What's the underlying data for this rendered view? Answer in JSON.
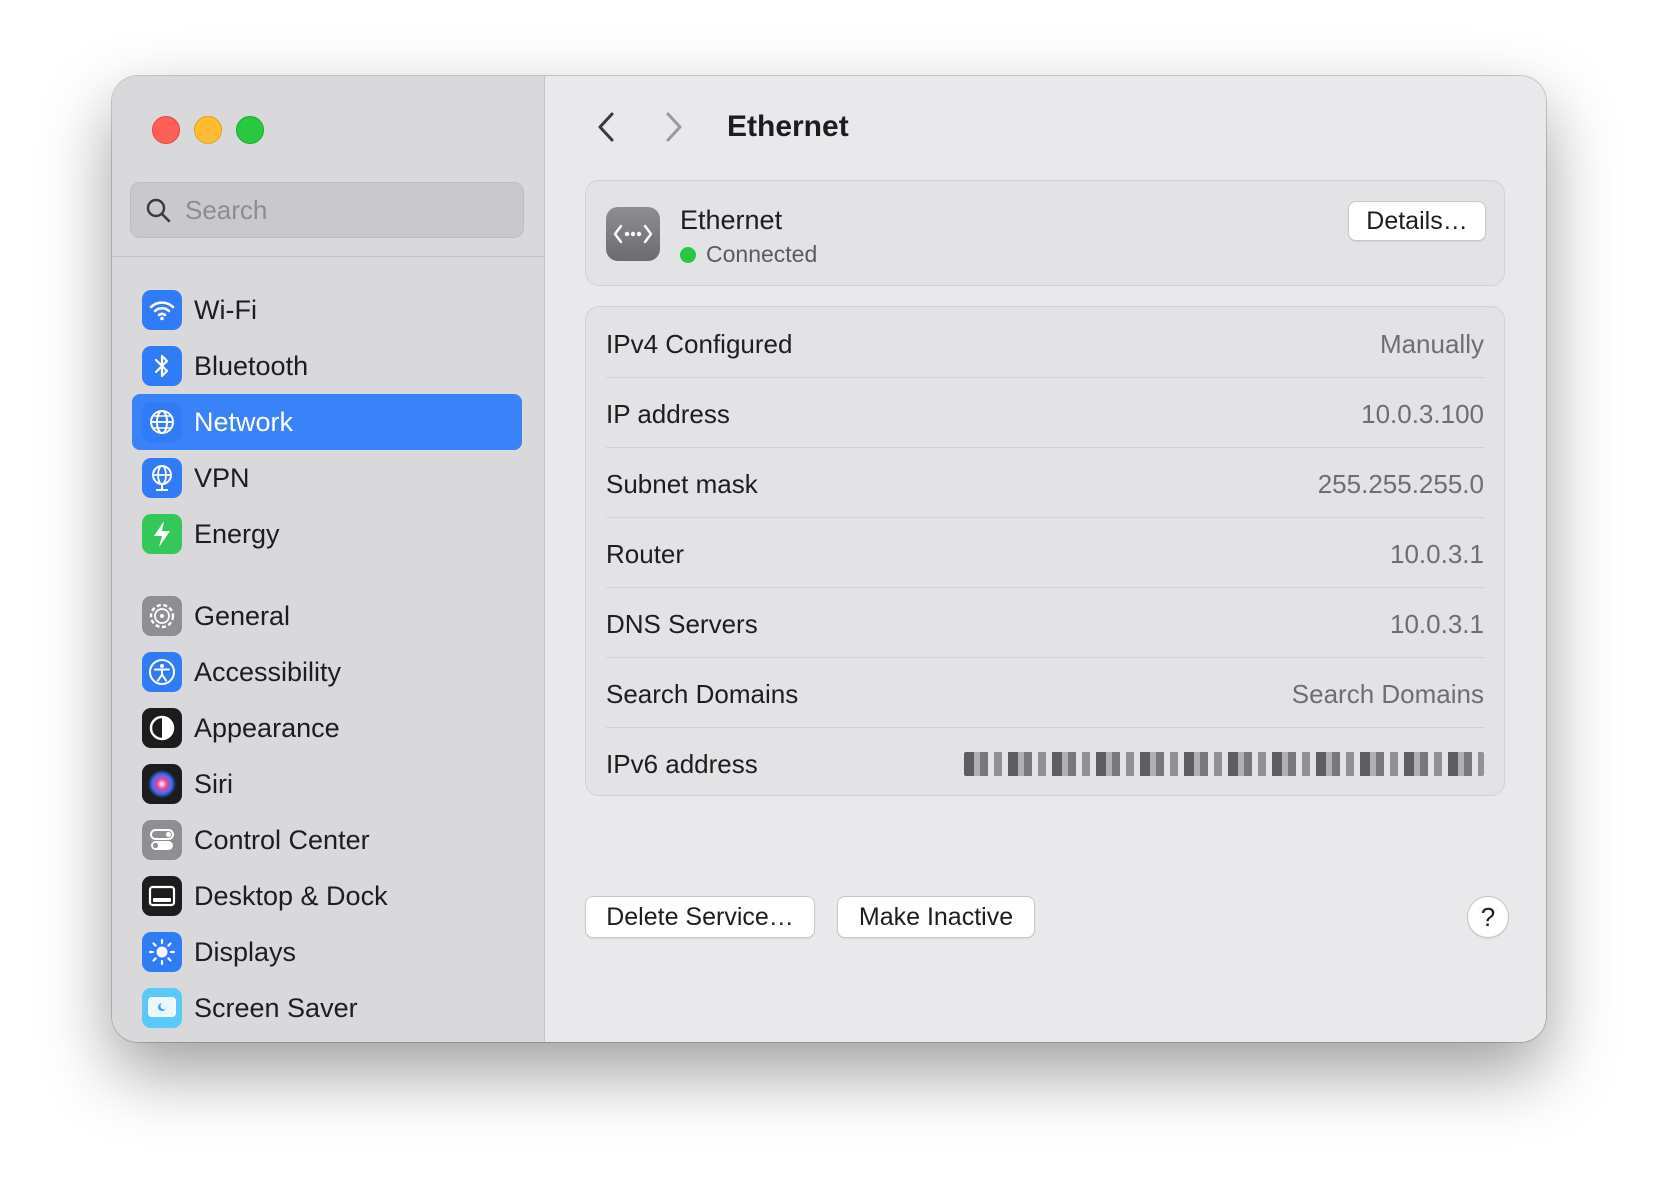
{
  "window": {
    "traffic_lights": [
      "close",
      "minimize",
      "zoom"
    ]
  },
  "sidebar": {
    "search_placeholder": "Search",
    "groups": [
      [
        {
          "label": "Wi-Fi",
          "icon": "wifi-icon",
          "color": "#2f7cf6"
        },
        {
          "label": "Bluetooth",
          "icon": "bluetooth-icon",
          "color": "#2f7cf6"
        },
        {
          "label": "Network",
          "icon": "globe-icon",
          "color": "#2f7cf6",
          "active": true
        },
        {
          "label": "VPN",
          "icon": "vpn-globe-icon",
          "color": "#2f7cf6"
        },
        {
          "label": "Energy",
          "icon": "bolt-icon",
          "color": "#35c759"
        }
      ],
      [
        {
          "label": "General",
          "icon": "gear-icon",
          "color": "#8e8e93"
        },
        {
          "label": "Accessibility",
          "icon": "accessibility-icon",
          "color": "#2f7cf6"
        },
        {
          "label": "Appearance",
          "icon": "appearance-icon",
          "color": "#1c1c1e"
        },
        {
          "label": "Siri",
          "icon": "siri-icon",
          "color": "#1c1c1e"
        },
        {
          "label": "Control Center",
          "icon": "toggles-icon",
          "color": "#8e8e93"
        },
        {
          "label": "Desktop & Dock",
          "icon": "dock-icon",
          "color": "#1c1c1e"
        },
        {
          "label": "Displays",
          "icon": "sun-icon",
          "color": "#2f7cf6"
        },
        {
          "label": "Screen Saver",
          "icon": "screensaver-icon",
          "color": "#5ac8fa"
        }
      ]
    ]
  },
  "main": {
    "title": "Ethernet",
    "service": {
      "name": "Ethernet",
      "status": "Connected",
      "details_label": "Details…"
    },
    "rows": [
      {
        "key": "IPv4 Configured",
        "value": "Manually"
      },
      {
        "key": "IP address",
        "value": "10.0.3.100"
      },
      {
        "key": "Subnet mask",
        "value": "255.255.255.0"
      },
      {
        "key": "Router",
        "value": "10.0.3.1"
      },
      {
        "key": "DNS Servers",
        "value": "10.0.3.1"
      },
      {
        "key": "Search Domains",
        "value": "Search Domains"
      },
      {
        "key": "IPv6 address",
        "value": "",
        "redacted": true
      }
    ],
    "actions": {
      "delete_label": "Delete Service…",
      "inactive_label": "Make Inactive",
      "help_label": "?"
    }
  }
}
